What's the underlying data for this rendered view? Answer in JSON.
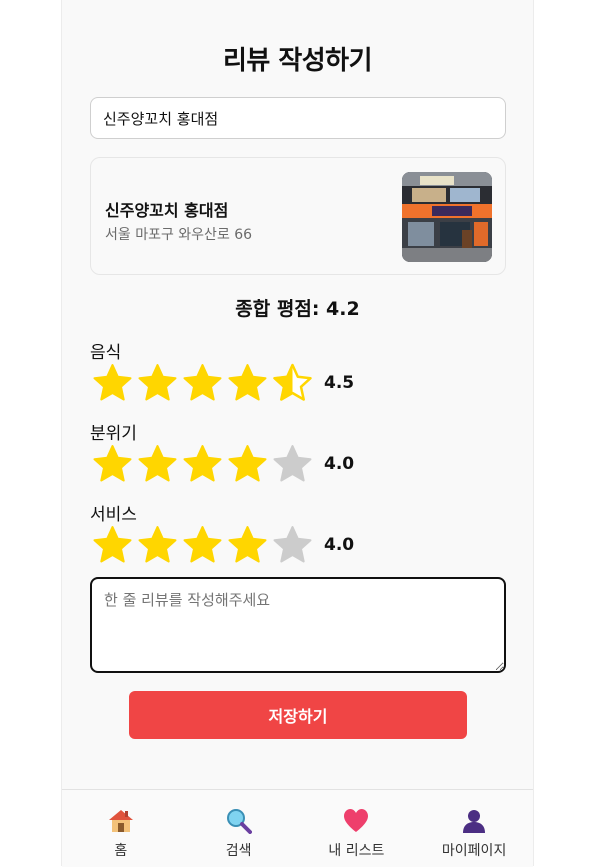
{
  "page": {
    "title": "리뷰 작성하기"
  },
  "search": {
    "value": "신주양꼬치 홍대점"
  },
  "restaurant": {
    "name": "신주양꼬치 홍대점",
    "address": "서울 마포구 와우산로 66"
  },
  "overall": {
    "label": "종합 평점: 4.2",
    "value": 4.2
  },
  "ratings": [
    {
      "label": "음식",
      "value": 4.5,
      "display": "4.5"
    },
    {
      "label": "분위기",
      "value": 4.0,
      "display": "4.0"
    },
    {
      "label": "서비스",
      "value": 4.0,
      "display": "4.0"
    }
  ],
  "review": {
    "placeholder": "한 줄 리뷰를 작성해주세요"
  },
  "actions": {
    "save_label": "저장하기"
  },
  "colors": {
    "star_on": "#FFD600",
    "star_off": "#CCCCCC",
    "save_button": "#F04545"
  },
  "nav": [
    {
      "label": "홈",
      "icon": "home-icon"
    },
    {
      "label": "검색",
      "icon": "search-icon"
    },
    {
      "label": "내 리스트",
      "icon": "heart-icon"
    },
    {
      "label": "마이페이지",
      "icon": "person-icon"
    }
  ]
}
